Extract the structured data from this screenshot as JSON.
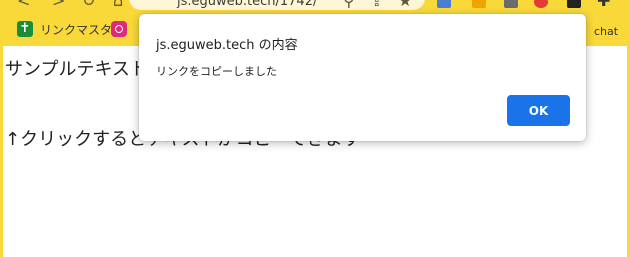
{
  "browser": {
    "address_text": "js.eguweb.tech/1742/",
    "theme_color": "#f9d83a",
    "nav_icons": [
      "back-icon",
      "forward-icon",
      "reload-icon",
      "home-icon"
    ],
    "omnibox_icons": [
      "search-icon",
      "share-icon",
      "bookmark-star-icon"
    ],
    "extension_icons": [
      "extension-a-icon",
      "extension-b-icon",
      "extension-c-icon",
      "extension-d-icon",
      "extension-e-icon",
      "puzzle-icon"
    ]
  },
  "bookmarks_bar": {
    "items": [
      {
        "label": "リンクマスタ",
        "icon": "green-cross-icon"
      },
      {
        "label": "",
        "icon": "instagram-icon"
      }
    ],
    "overflow_label": "chat"
  },
  "page": {
    "sample_text": "サンプルテキスト",
    "hint_text": "↑クリックするとテキストがコピーできます"
  },
  "dialog": {
    "title": "js.eguweb.tech の内容",
    "message": "リンクをコピーしました",
    "ok_label": "OK",
    "accent": "#1a73e8"
  }
}
